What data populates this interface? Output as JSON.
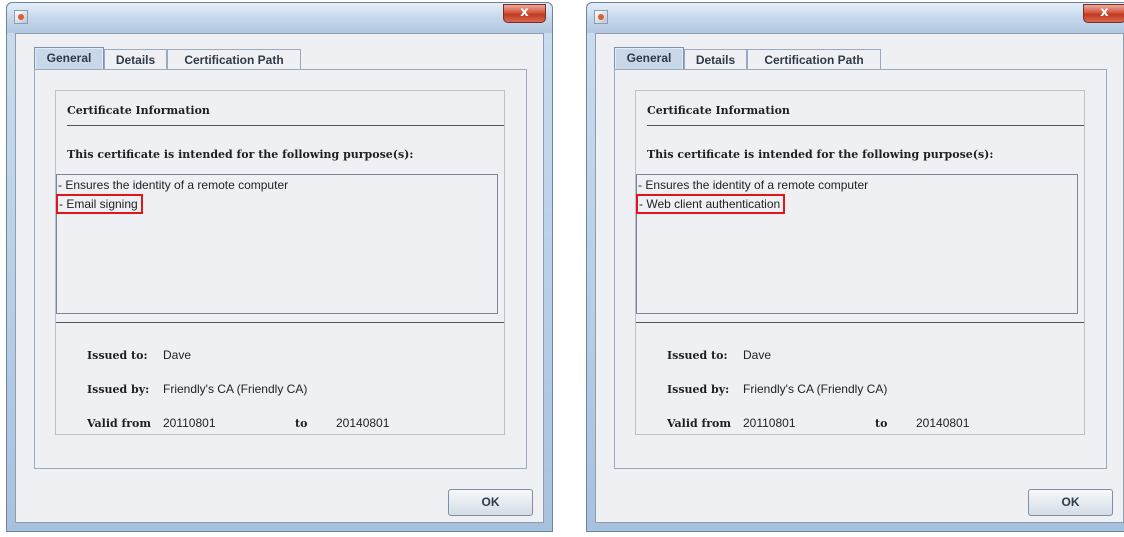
{
  "dialogs": [
    {
      "tabs": [
        "General",
        "Details",
        "Certification Path"
      ],
      "section_title": "Certificate Information",
      "purpose_heading": "This certificate is intended for the following purpose(s):",
      "purposes": [
        "- Ensures the identity of a remote computer",
        "- Email signing"
      ],
      "issued_to_label": "Issued to:",
      "issued_to": "Dave",
      "issued_by_label": "Issued by:",
      "issued_by": "Friendly's CA (Friendly CA)",
      "valid_from_label": "Valid from",
      "valid_from": "20110801",
      "to_label": "to",
      "valid_to": "20140801",
      "ok_label": "OK",
      "close_glyph": "x"
    },
    {
      "tabs": [
        "General",
        "Details",
        "Certification Path"
      ],
      "section_title": "Certificate Information",
      "purpose_heading": "This certificate is intended for the following purpose(s):",
      "purposes": [
        "- Ensures the identity of a remote computer",
        "- Web client authentication"
      ],
      "issued_to_label": "Issued to:",
      "issued_to": "Dave",
      "issued_by_label": "Issued by:",
      "issued_by": "Friendly's CA (Friendly CA)",
      "valid_from_label": "Valid from",
      "valid_from": "20110801",
      "to_label": "to",
      "valid_to": "20140801",
      "ok_label": "OK",
      "close_glyph": "x"
    }
  ],
  "highlight_color": "#e3141a",
  "icons": {
    "app": "java-app-icon",
    "close": "close-icon"
  }
}
